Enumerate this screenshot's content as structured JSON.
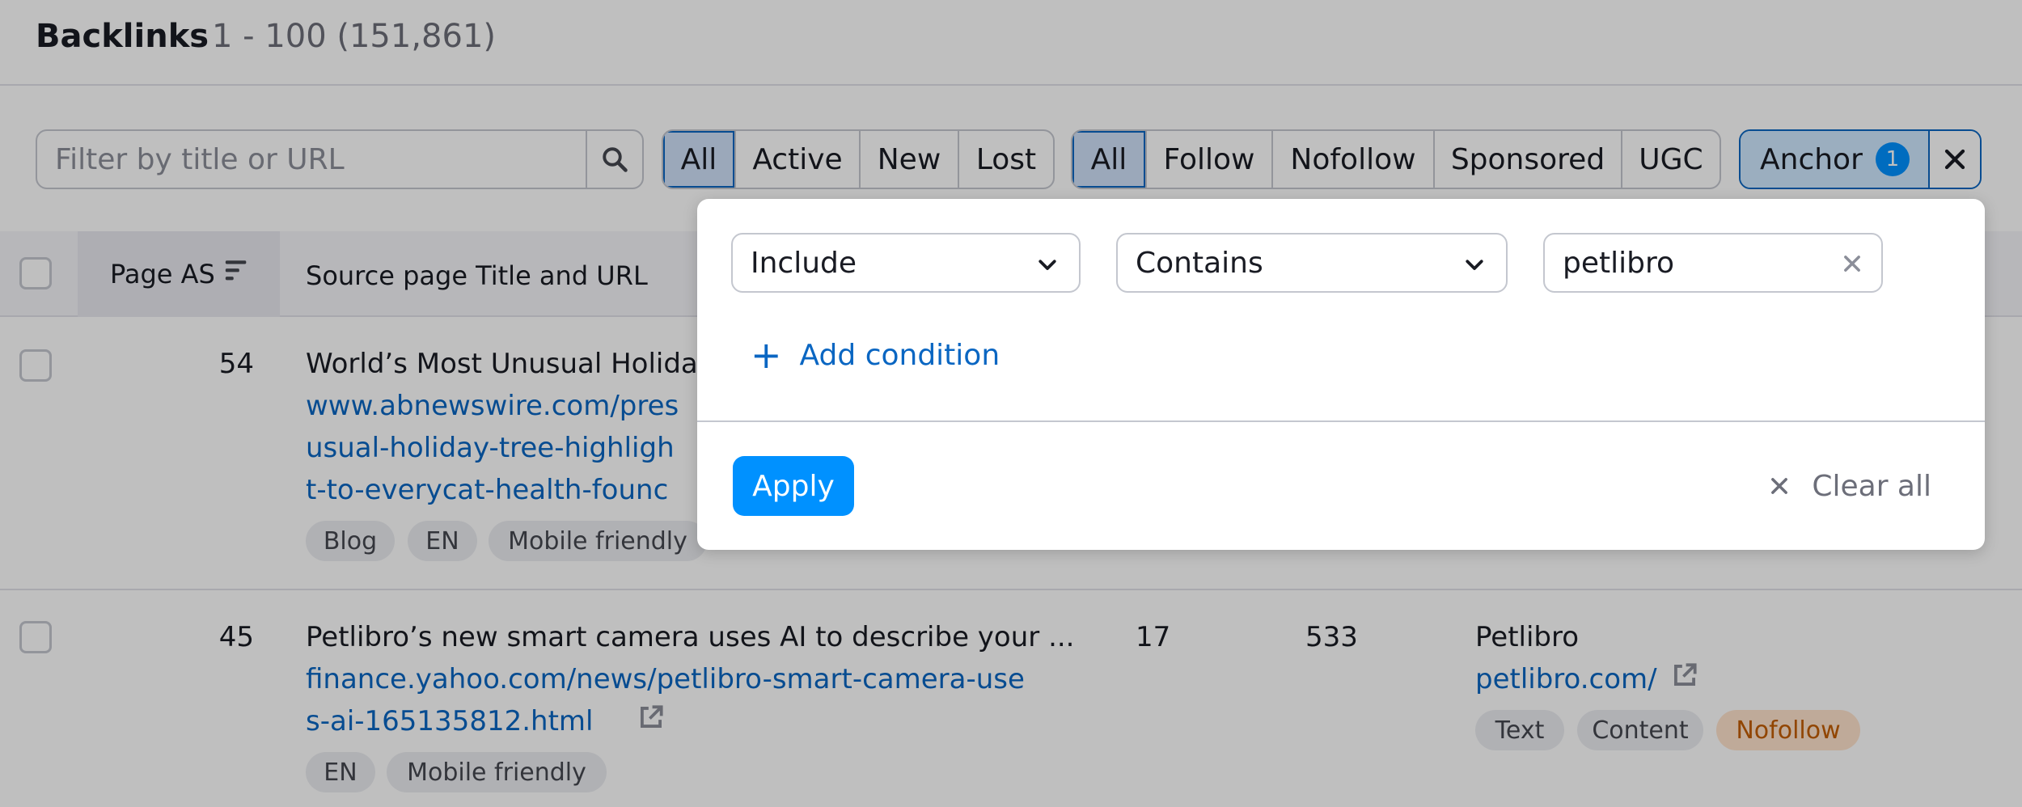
{
  "header": {
    "title": "Backlinks",
    "count": "1 - 100 (151,861)"
  },
  "search": {
    "placeholder": "Filter by title or URL"
  },
  "status_filter": {
    "options": [
      "All",
      "Active",
      "New",
      "Lost"
    ],
    "selected": "All"
  },
  "type_filter": {
    "options": [
      "All",
      "Follow",
      "Nofollow",
      "Sponsored",
      "UGC"
    ],
    "selected": "All"
  },
  "anchor_filter": {
    "label": "Anchor",
    "badge": "1"
  },
  "table": {
    "headers": {
      "page_as": "Page AS",
      "source": "Source page Title and URL"
    },
    "rows": [
      {
        "page_as": "54",
        "title": "World’s Most Unusual Holida",
        "url_lines": [
          "www.abnewswire.com/pres",
          "usual-holiday-tree-highligh",
          "t-to-everycat-health-founc"
        ],
        "tags": [
          "Blog",
          "EN",
          "Mobile friendly"
        ]
      },
      {
        "page_as": "45",
        "title": "Petlibro’s new smart camera uses AI to describe your ...",
        "url_lines": [
          "finance.yahoo.com/news/petlibro-smart-camera-use",
          "s-ai-165135812.html"
        ],
        "tags": [
          "EN",
          "Mobile friendly"
        ],
        "col3": "17",
        "col4": "533",
        "anchor_text": "Petlibro",
        "target_url": "petlibro.com/",
        "link_tags": [
          "Text",
          "Content",
          "Nofollow"
        ]
      }
    ]
  },
  "popup": {
    "include_select": "Include",
    "match_select": "Contains",
    "value": "petlibro",
    "add_condition": "Add condition",
    "apply": "Apply",
    "clear_all": "Clear all"
  },
  "colors": {
    "accent": "#0091ff",
    "link": "#0a66c2",
    "nofollow_tag_bg": "#ffe3cc"
  }
}
